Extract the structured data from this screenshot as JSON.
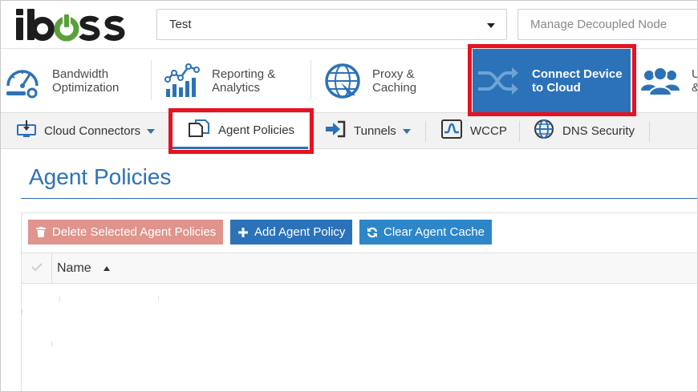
{
  "brand": {
    "logo_text": "iboss",
    "accent": "#2b72b8",
    "logo_power_color": "#5ba03a"
  },
  "header": {
    "profile_select": {
      "value": "Test"
    },
    "node_input": {
      "placeholder": "Manage Decoupled Node"
    }
  },
  "main_nav": {
    "items": [
      {
        "label": "Bandwidth\nOptimization",
        "icon": "speedometer-icon"
      },
      {
        "label": "Reporting &\nAnalytics",
        "icon": "analytics-chart-icon"
      },
      {
        "label": "Proxy &\nCaching",
        "icon": "globe-proxy-icon"
      },
      {
        "label": "Connect Device\nto Cloud",
        "icon": "shuffle-arrows-icon",
        "active": true
      },
      {
        "label": "U\n&",
        "icon": "users-icon"
      }
    ]
  },
  "sub_nav": {
    "items": [
      {
        "label": "Cloud Connectors",
        "icon": "download-monitor-icon",
        "dropdown": true
      },
      {
        "label": "Agent Policies",
        "icon": "documents-icon",
        "active": true
      },
      {
        "label": "Tunnels",
        "icon": "sign-in-arrow-icon",
        "dropdown": true
      },
      {
        "label": "WCCP",
        "icon": "wave-icon"
      },
      {
        "label": "DNS Security",
        "icon": "globe-icon"
      }
    ]
  },
  "content": {
    "page_title": "Agent Policies",
    "toolbar": {
      "delete_label": "Delete Selected Agent Policies",
      "add_label": "Add Agent Policy",
      "clear_label": "Clear Agent Cache"
    },
    "table": {
      "columns": [
        "Name"
      ]
    }
  },
  "colors": {
    "highlight": "#e8111f",
    "delete_button": "#e0948c",
    "primary_button": "#2b72b8"
  }
}
